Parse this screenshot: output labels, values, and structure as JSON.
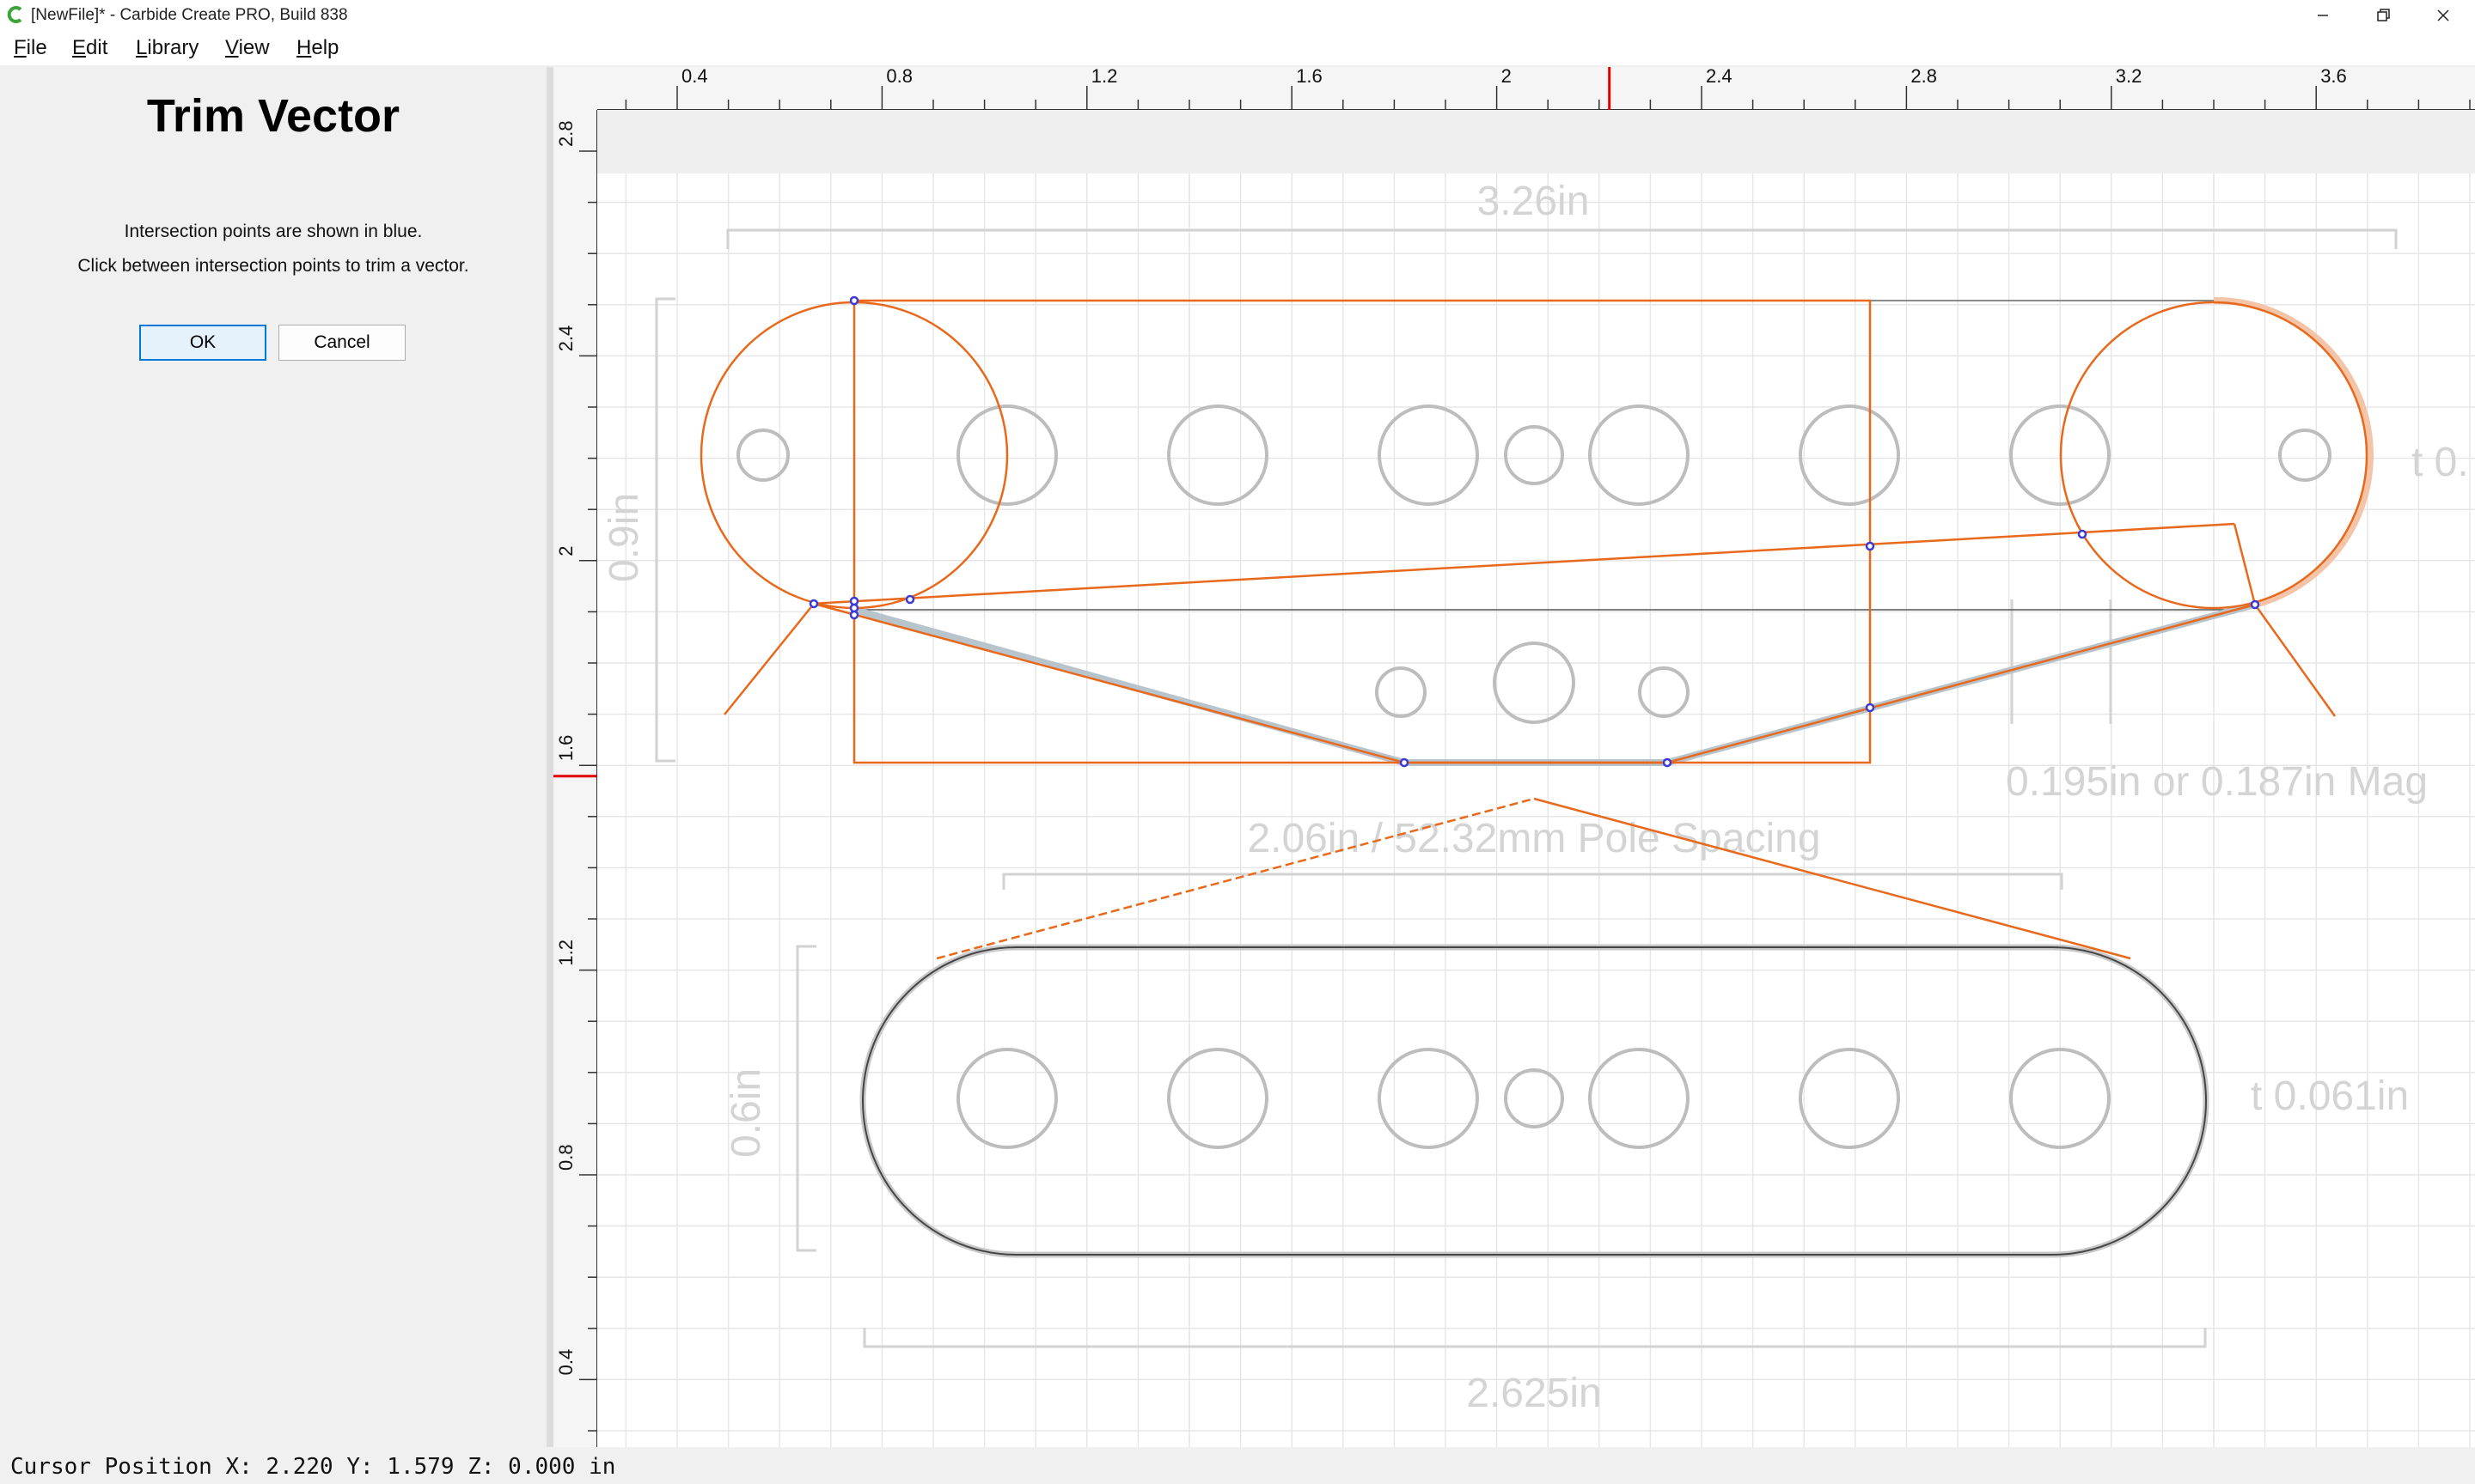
{
  "window": {
    "title": "[NewFile]* - Carbide Create PRO, Build 838",
    "icons": {
      "app": "carbide-c-icon",
      "minimize": "minimize-icon",
      "maximize": "restore-icon",
      "close": "close-icon"
    }
  },
  "menu": [
    "File",
    "Edit",
    "Library",
    "View",
    "Help"
  ],
  "panel": {
    "title": "Trim Vector",
    "line1": "Intersection points are shown in blue.",
    "line2": "Click between intersection points to trim a vector.",
    "ok": "OK",
    "cancel": "Cancel"
  },
  "rulers": {
    "h_labels": [
      "0.4",
      "0.8",
      "1.2",
      "1.6",
      "2",
      "2.4",
      "2.8",
      "3.2",
      "3.6"
    ],
    "v_labels": [
      "2.8",
      "2.4",
      "2",
      "1.6",
      "1.2",
      "0.8",
      "0.4"
    ]
  },
  "drawing": {
    "dim_top_width": "3.26in",
    "dim_right_hole": "t 0.",
    "dim_left_top": "0.9in",
    "dim_magnet": "0.195in or 0.187in Mag",
    "dim_pole_spacing": "2.06in / 52.32mm Pole Spacing",
    "dim_left_bottom": "0.6in",
    "dim_thickness": "t 0.061in",
    "dim_bottom_width": "2.625in"
  },
  "status": {
    "text": "Cursor Position X: 2.220 Y: 1.579 Z: 0.000 in",
    "cursor_x": 2.22,
    "cursor_y": 1.579
  },
  "colors": {
    "accent_orange": "#e8691c",
    "intersection_blue": "#3a3ad6",
    "cursor_red": "#e00000",
    "grid_line": "#e4e4e4",
    "faded_dim": "#d4d4d4"
  }
}
